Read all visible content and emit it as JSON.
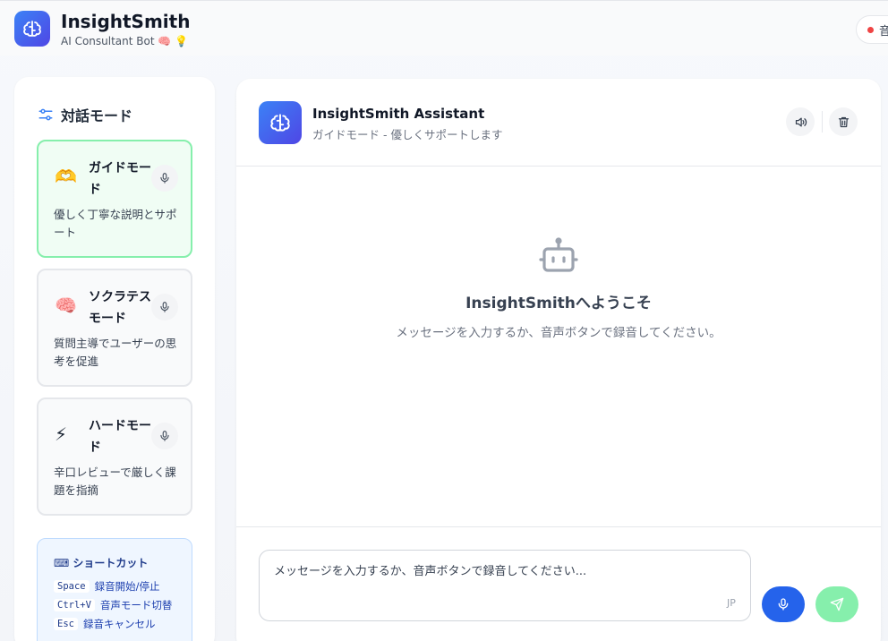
{
  "app": {
    "title": "InsightSmith",
    "subtitle": "AI Consultant Bot 🧠 💡",
    "status_label": "音"
  },
  "sidebar": {
    "heading": "対話モード",
    "modes": [
      {
        "emoji": "🫶",
        "name": "ガイドモード",
        "desc": "優しく丁寧な説明とサポート",
        "active": true
      },
      {
        "emoji": "🧠",
        "name": "ソクラテスモード",
        "desc": "質問主導でユーザーの思考を促進",
        "active": false
      },
      {
        "emoji": "⚡",
        "name": "ハードモード",
        "desc": "辛口レビューで厳しく課題を指摘",
        "active": false
      }
    ],
    "shortcuts": {
      "title": "ショートカット",
      "items": [
        {
          "key": "Space",
          "label": "録音開始/停止"
        },
        {
          "key": "Ctrl+V",
          "label": "音声モード切替"
        },
        {
          "key": "Esc",
          "label": "録音キャンセル"
        }
      ]
    }
  },
  "chat": {
    "title": "InsightSmith Assistant",
    "subtitle": "ガイドモード - 優しくサポートします",
    "welcome_title": "InsightSmithへようこそ",
    "welcome_sub": "メッセージを入力するか、音声ボタンで録音してください。",
    "input_placeholder": "メッセージを入力するか、音声ボタンで録音してください...",
    "input_value": "",
    "lang": "JP"
  },
  "colors": {
    "brand": "#3b82f6",
    "active_mode_border": "#86efac",
    "mic_button": "#2563eb",
    "send_button": "#86efac",
    "status_dot": "#ef4444"
  }
}
